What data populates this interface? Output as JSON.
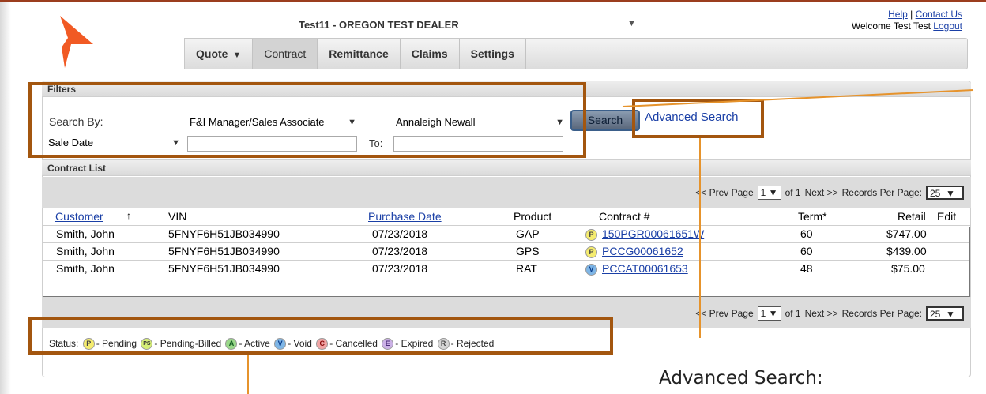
{
  "header": {
    "dealer_name": "Test11 - OREGON TEST DEALER",
    "help_link": "Help",
    "contact_link": "Contact Us",
    "separator": "|",
    "welcome_text": "Welcome Test Test",
    "logout_link": "Logout",
    "logo_color": "#f15a24"
  },
  "nav": {
    "items": [
      {
        "label": "Quote",
        "has_dropdown": true
      },
      {
        "label": "Contract",
        "active": true
      },
      {
        "label": "Remittance"
      },
      {
        "label": "Claims"
      },
      {
        "label": "Settings"
      }
    ]
  },
  "filters": {
    "title": "Filters",
    "search_by_label": "Search By:",
    "search_by_value": "F&I Manager/Sales Associate",
    "person_value": "Annaleigh Newall",
    "date_field_value": "Sale Date",
    "from_value": "",
    "to_label": "To:",
    "to_value": "",
    "search_button": "Search",
    "advanced_search_link": "Advanced Search"
  },
  "contract_list": {
    "title": "Contract List",
    "pager": {
      "prev": "<< Prev Page",
      "page": "1",
      "of": "of 1",
      "next": "Next >>",
      "rpp_label": "Records Per Page:",
      "rpp_value": "25"
    },
    "columns": {
      "customer": "Customer",
      "sort_indicator": "↑",
      "vin": "VIN",
      "purchase_date": "Purchase Date",
      "product": "Product",
      "contract": "Contract #",
      "term": "Term*",
      "retail": "Retail",
      "edit": "Edit"
    },
    "rows": [
      {
        "customer": "Smith, John",
        "vin": "5FNYF6H51JB034990",
        "purchase_date": "07/23/2018",
        "product": "GAP",
        "status": "P",
        "contract": "150PGR00061651W",
        "term": "60",
        "retail": "$747.00"
      },
      {
        "customer": "Smith, John",
        "vin": "5FNYF6H51JB034990",
        "purchase_date": "07/23/2018",
        "product": "GPS",
        "status": "P",
        "contract": "PCCG00061652",
        "term": "60",
        "retail": "$439.00"
      },
      {
        "customer": "Smith, John",
        "vin": "5FNYF6H51JB034990",
        "purchase_date": "07/23/2018",
        "product": "RAT",
        "status": "V",
        "contract": "PCCAT00061653",
        "term": "48",
        "retail": "$75.00"
      }
    ]
  },
  "status_legend": {
    "label": "Status:",
    "items": [
      {
        "code": "P",
        "text": "- Pending"
      },
      {
        "code": "PS",
        "text": "- Pending-Billed"
      },
      {
        "code": "A",
        "text": "- Active"
      },
      {
        "code": "V",
        "text": "- Void"
      },
      {
        "code": "C",
        "text": "- Cancelled"
      },
      {
        "code": "E",
        "text": "- Expired"
      },
      {
        "code": "R",
        "text": "- Rejected"
      }
    ]
  },
  "annotation": {
    "caption": "Advanced Search:",
    "highlight_color": "#a3560f",
    "line_color": "#e6932c"
  }
}
